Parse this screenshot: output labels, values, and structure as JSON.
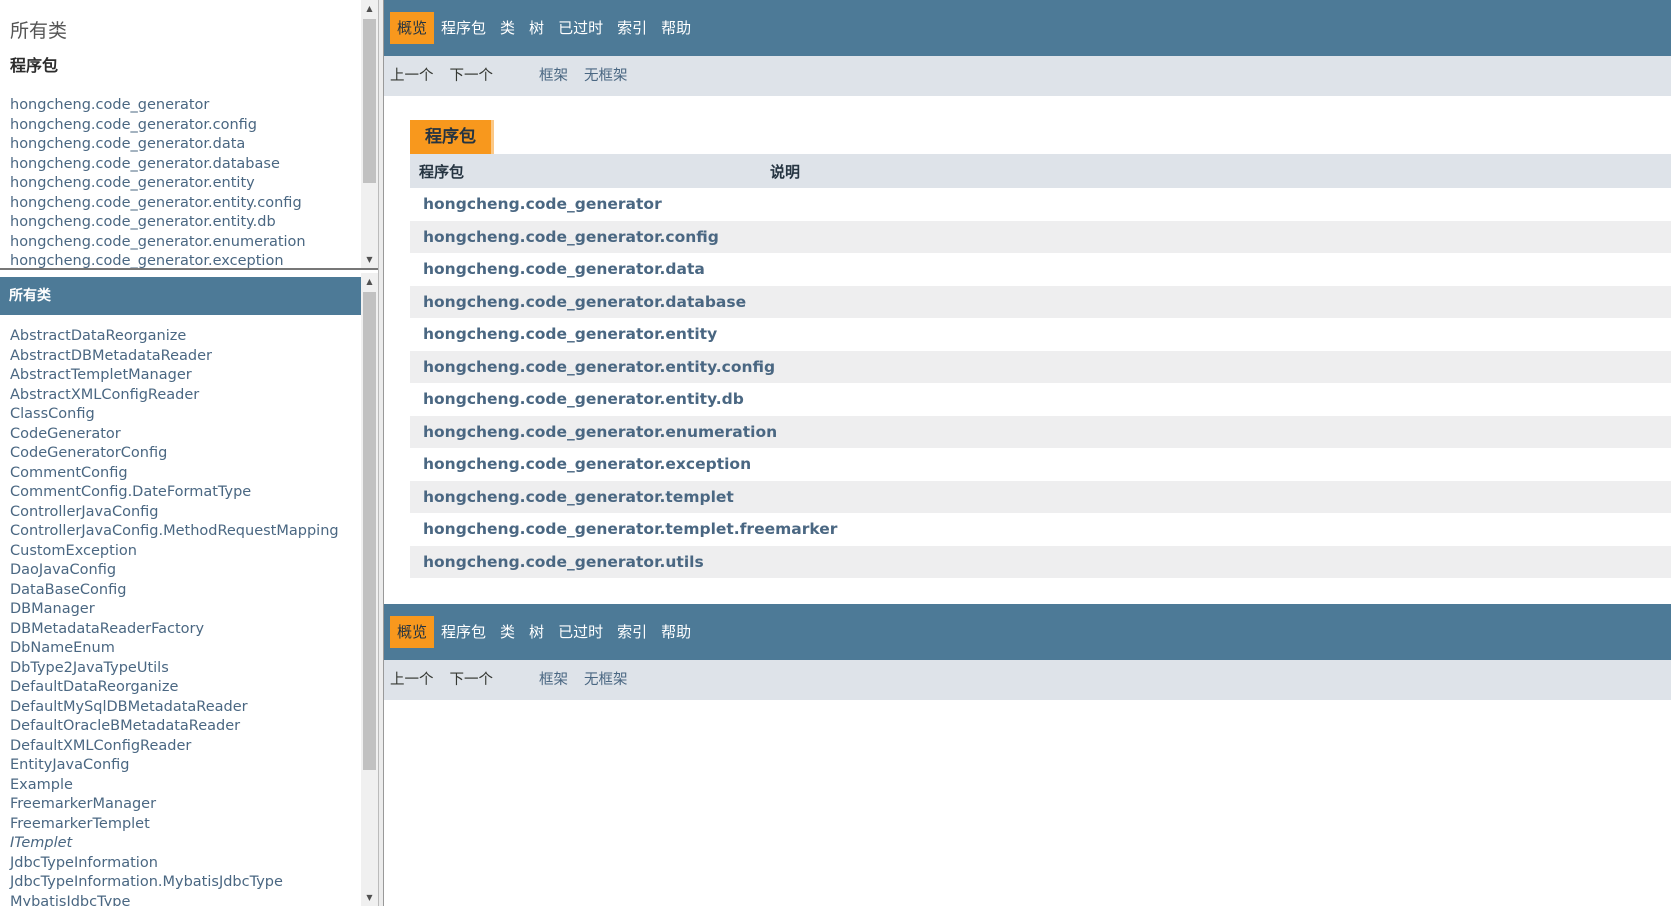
{
  "left_top": {
    "title": "所有类",
    "subtitle": "程序包",
    "packages": [
      "hongcheng.code_generator",
      "hongcheng.code_generator.config",
      "hongcheng.code_generator.data",
      "hongcheng.code_generator.database",
      "hongcheng.code_generator.entity",
      "hongcheng.code_generator.entity.config",
      "hongcheng.code_generator.entity.db",
      "hongcheng.code_generator.enumeration",
      "hongcheng.code_generator.exception"
    ]
  },
  "left_bottom": {
    "bar_title": "所有类",
    "classes": [
      "AbstractDataReorganize",
      "AbstractDBMetadataReader",
      "AbstractTempletManager",
      "AbstractXMLConfigReader",
      "ClassConfig",
      "CodeGenerator",
      "CodeGeneratorConfig",
      "CommentConfig",
      "CommentConfig.DateFormatType",
      "ControllerJavaConfig",
      "ControllerJavaConfig.MethodRequestMapping",
      "CustomException",
      "DaoJavaConfig",
      "DataBaseConfig",
      "DBManager",
      "DBMetadataReaderFactory",
      "DbNameEnum",
      "DbType2JavaTypeUtils",
      "DefaultDataReorganize",
      "DefaultMySqlDBMetadataReader",
      "DefaultOracleBMetadataReader",
      "DefaultXMLConfigReader",
      "EntityJavaConfig",
      "Example",
      "FreemarkerManager",
      "FreemarkerTemplet",
      "ITemplet",
      "JdbcTypeInformation",
      "JdbcTypeInformation.MybatisJdbcType",
      "MybatisJdbcType"
    ],
    "italic_item": "ITemplet"
  },
  "nav": {
    "items": [
      "概览",
      "程序包",
      "类",
      "树",
      "已过时",
      "索引",
      "帮助"
    ],
    "active": "概览",
    "prev": "上一个",
    "next": "下一个",
    "frames": "框架",
    "no_frames": "无框架"
  },
  "summary": {
    "caption": "程序包",
    "col_package": "程序包",
    "col_desc": "说明",
    "rows": [
      "hongcheng.code_generator",
      "hongcheng.code_generator.config",
      "hongcheng.code_generator.data",
      "hongcheng.code_generator.database",
      "hongcheng.code_generator.entity",
      "hongcheng.code_generator.entity.config",
      "hongcheng.code_generator.entity.db",
      "hongcheng.code_generator.enumeration",
      "hongcheng.code_generator.exception",
      "hongcheng.code_generator.templet",
      "hongcheng.code_generator.templet.freemarker",
      "hongcheng.code_generator.utils"
    ]
  },
  "colors": {
    "nav_bg": "#4d7a97",
    "active_tab": "#f8981d",
    "subnav_bg": "#dee3e9",
    "link": "#4a6782",
    "alt_row": "#eeeeef"
  }
}
